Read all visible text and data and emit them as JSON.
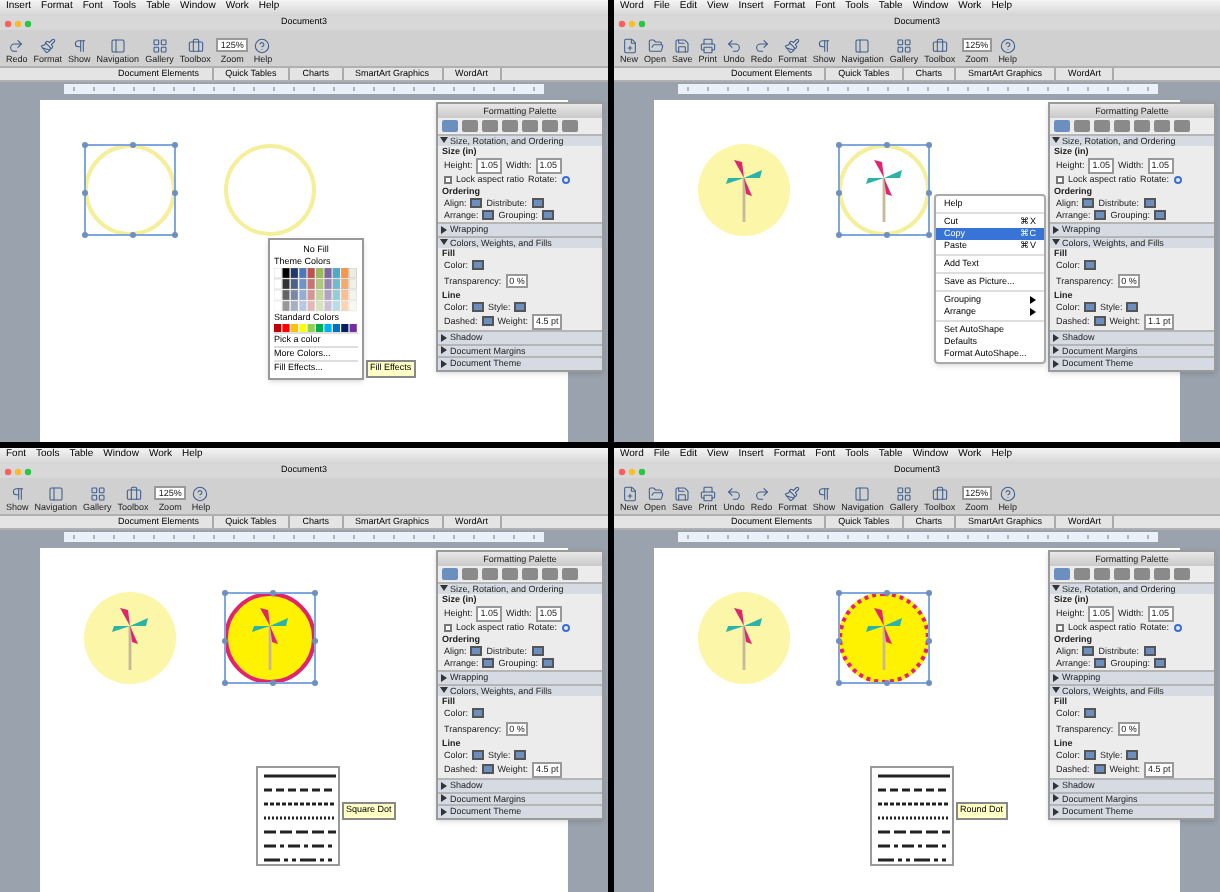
{
  "panes": [
    {
      "menus": [
        "Insert",
        "Format",
        "Font",
        "Tools",
        "Table",
        "Window",
        "Work",
        "Help"
      ],
      "title": "Document3",
      "toolbar": [
        {
          "kind": "redo",
          "label": "Redo"
        },
        {
          "kind": "format",
          "label": "Format"
        },
        {
          "kind": "show",
          "label": "Show"
        },
        {
          "kind": "navigation",
          "label": "Navigation"
        },
        {
          "kind": "gallery",
          "label": "Gallery"
        },
        {
          "kind": "toolbox",
          "label": "Toolbox"
        },
        {
          "kind": "zoom",
          "label": "Zoom",
          "value": "125%"
        },
        {
          "kind": "help",
          "label": "Help"
        }
      ],
      "ribbon_tabs": [
        "Document Elements",
        "Quick Tables",
        "Charts",
        "SmartArt Graphics",
        "WordArt"
      ],
      "shapes": [
        {
          "kind": "ring",
          "selected": true
        },
        {
          "kind": "ring",
          "selected": false
        }
      ],
      "palette": {
        "title": "Formatting Palette",
        "rows": [
          {
            "kind": "header",
            "text": "Size, Rotation, and Ordering",
            "expanded": true
          },
          {
            "kind": "label",
            "text": "Size (in)"
          },
          {
            "kind": "fields",
            "items": [
              {
                "label": "Height:",
                "value": "1.05"
              },
              {
                "label": "Width:",
                "value": "1.05"
              }
            ]
          },
          {
            "kind": "check",
            "text": "Lock aspect ratio",
            "checked": false,
            "extra": "Rotate:"
          },
          {
            "kind": "label",
            "text": "Ordering"
          },
          {
            "kind": "fields",
            "items": [
              {
                "label": "Align:"
              },
              {
                "label": "Distribute:"
              }
            ]
          },
          {
            "kind": "fields",
            "items": [
              {
                "label": "Arrange:"
              },
              {
                "label": "Grouping:"
              }
            ]
          },
          {
            "kind": "header",
            "text": "Wrapping",
            "expanded": false
          },
          {
            "kind": "header",
            "text": "Colors, Weights, and Fills",
            "expanded": true
          },
          {
            "kind": "label",
            "text": "Fill"
          },
          {
            "kind": "fields",
            "items": [
              {
                "label": "Color:"
              }
            ]
          },
          {
            "kind": "fields",
            "items": [
              {
                "label": "Transparency:",
                "value": "0 %"
              }
            ]
          },
          {
            "kind": "label",
            "text": "Line"
          },
          {
            "kind": "fields",
            "items": [
              {
                "label": "Color:"
              },
              {
                "label": "Style:"
              }
            ]
          },
          {
            "kind": "fields",
            "items": [
              {
                "label": "Dashed:"
              },
              {
                "label": "Weight:",
                "value": "4.5 pt"
              }
            ]
          },
          {
            "kind": "header",
            "text": "Shadow",
            "expanded": false
          },
          {
            "kind": "header",
            "text": "Document Margins",
            "expanded": false
          },
          {
            "kind": "header",
            "text": "Document Theme",
            "expanded": false
          }
        ]
      },
      "overlay": {
        "kind": "color_menu",
        "no_fill": "No Fill",
        "theme": "Theme Colors",
        "standard": "Standard Colors",
        "items": [
          "Pick a color",
          "More Colors...",
          "Fill Effects..."
        ],
        "tooltip": "Fill Effects"
      }
    },
    {
      "menus": [
        "Word",
        "File",
        "Edit",
        "View",
        "Insert",
        "Format",
        "Font",
        "Tools",
        "Table",
        "Window",
        "Work",
        "Help"
      ],
      "title": "Document3",
      "toolbar": [
        {
          "kind": "new",
          "label": "New"
        },
        {
          "kind": "open",
          "label": "Open"
        },
        {
          "kind": "save",
          "label": "Save"
        },
        {
          "kind": "print",
          "label": "Print"
        },
        {
          "kind": "undo",
          "label": "Undo"
        },
        {
          "kind": "redo",
          "label": "Redo"
        },
        {
          "kind": "format",
          "label": "Format"
        },
        {
          "kind": "show",
          "label": "Show"
        },
        {
          "kind": "navigation",
          "label": "Navigation"
        },
        {
          "kind": "gallery",
          "label": "Gallery"
        },
        {
          "kind": "toolbox",
          "label": "Toolbox"
        },
        {
          "kind": "zoom",
          "label": "Zoom",
          "value": "125%"
        },
        {
          "kind": "help",
          "label": "Help"
        }
      ],
      "ribbon_tabs": [
        "Document Elements",
        "Quick Tables",
        "Charts",
        "SmartArt Graphics",
        "WordArt"
      ],
      "shapes": [
        {
          "kind": "pale_pinwheel",
          "selected": false
        },
        {
          "kind": "ring_pinwheel",
          "selected": true
        }
      ],
      "palette": {
        "title": "Formatting Palette",
        "rows": [
          {
            "kind": "header",
            "text": "Size, Rotation, and Ordering",
            "expanded": true
          },
          {
            "kind": "label",
            "text": "Size (in)"
          },
          {
            "kind": "fields",
            "items": [
              {
                "label": "Height:",
                "value": "1.05"
              },
              {
                "label": "Width:",
                "value": "1.05"
              }
            ]
          },
          {
            "kind": "check",
            "text": "Lock aspect ratio",
            "checked": false,
            "extra": "Rotate:"
          },
          {
            "kind": "label",
            "text": "Ordering"
          },
          {
            "kind": "fields",
            "items": [
              {
                "label": "Align:"
              },
              {
                "label": "Distribute:"
              }
            ]
          },
          {
            "kind": "fields",
            "items": [
              {
                "label": "Arrange:"
              },
              {
                "label": "Grouping:"
              }
            ]
          },
          {
            "kind": "header",
            "text": "Wrapping",
            "expanded": false
          },
          {
            "kind": "header",
            "text": "Colors, Weights, and Fills",
            "expanded": true
          },
          {
            "kind": "label",
            "text": "Fill"
          },
          {
            "kind": "fields",
            "items": [
              {
                "label": "Color:"
              }
            ]
          },
          {
            "kind": "fields",
            "items": [
              {
                "label": "Transparency:",
                "value": "0 %"
              }
            ]
          },
          {
            "kind": "label",
            "text": "Line"
          },
          {
            "kind": "fields",
            "items": [
              {
                "label": "Color:"
              },
              {
                "label": "Style:"
              }
            ]
          },
          {
            "kind": "fields",
            "items": [
              {
                "label": "Dashed:"
              },
              {
                "label": "Weight:",
                "value": "1.1 pt"
              }
            ]
          },
          {
            "kind": "header",
            "text": "Shadow",
            "expanded": false
          },
          {
            "kind": "header",
            "text": "Document Margins",
            "expanded": false
          },
          {
            "kind": "header",
            "text": "Document Theme",
            "expanded": false
          }
        ]
      },
      "overlay": {
        "kind": "context_menu",
        "items": [
          {
            "kind": "item",
            "label": "Help",
            "selected": false,
            "submenu": false
          },
          {
            "kind": "separator"
          },
          {
            "kind": "item",
            "label": "Cut",
            "shortcut": "⌘X",
            "selected": false,
            "submenu": false
          },
          {
            "kind": "item",
            "label": "Copy",
            "shortcut": "⌘C",
            "selected": true,
            "submenu": false
          },
          {
            "kind": "item",
            "label": "Paste",
            "shortcut": "⌘V",
            "selected": false,
            "submenu": false
          },
          {
            "kind": "separator"
          },
          {
            "kind": "item",
            "label": "Add Text",
            "selected": false,
            "submenu": false
          },
          {
            "kind": "separator"
          },
          {
            "kind": "item",
            "label": "Save as Picture...",
            "selected": false,
            "submenu": false
          },
          {
            "kind": "separator"
          },
          {
            "kind": "item",
            "label": "Grouping",
            "selected": false,
            "submenu": true
          },
          {
            "kind": "item",
            "label": "Arrange",
            "selected": false,
            "submenu": true
          },
          {
            "kind": "separator"
          },
          {
            "kind": "item",
            "label": "Set AutoShape Defaults",
            "selected": false,
            "submenu": false
          },
          {
            "kind": "item",
            "label": "Format AutoShape...",
            "selected": false,
            "submenu": false
          }
        ]
      }
    },
    {
      "menus": [
        "Font",
        "Tools",
        "Table",
        "Window",
        "Work",
        "Help"
      ],
      "title": "Document3",
      "toolbar": [
        {
          "kind": "show",
          "label": "Show"
        },
        {
          "kind": "navigation",
          "label": "Navigation"
        },
        {
          "kind": "gallery",
          "label": "Gallery"
        },
        {
          "kind": "toolbox",
          "label": "Toolbox"
        },
        {
          "kind": "zoom",
          "label": "Zoom",
          "value": "125%"
        },
        {
          "kind": "help",
          "label": "Help"
        }
      ],
      "ribbon_tabs": [
        "Document Elements",
        "Quick Tables",
        "Charts",
        "SmartArt Graphics",
        "WordArt"
      ],
      "shapes": [
        {
          "kind": "pale_pinwheel",
          "selected": false
        },
        {
          "kind": "outlined_pinwheel",
          "selected": true
        }
      ],
      "palette": {
        "title": "Formatting Palette",
        "rows": [
          {
            "kind": "header",
            "text": "Size, Rotation, and Ordering",
            "expanded": true
          },
          {
            "kind": "label",
            "text": "Size (in)"
          },
          {
            "kind": "fields",
            "items": [
              {
                "label": "Height:",
                "value": "1.05"
              },
              {
                "label": "Width:",
                "value": "1.05"
              }
            ]
          },
          {
            "kind": "check",
            "text": "Lock aspect ratio",
            "checked": false,
            "extra": "Rotate:"
          },
          {
            "kind": "label",
            "text": "Ordering"
          },
          {
            "kind": "fields",
            "items": [
              {
                "label": "Align:"
              },
              {
                "label": "Distribute:"
              }
            ]
          },
          {
            "kind": "fields",
            "items": [
              {
                "label": "Arrange:"
              },
              {
                "label": "Grouping:"
              }
            ]
          },
          {
            "kind": "header",
            "text": "Wrapping",
            "expanded": false
          },
          {
            "kind": "header",
            "text": "Colors, Weights, and Fills",
            "expanded": true
          },
          {
            "kind": "label",
            "text": "Fill"
          },
          {
            "kind": "fields",
            "items": [
              {
                "label": "Color:"
              }
            ]
          },
          {
            "kind": "fields",
            "items": [
              {
                "label": "Transparency:",
                "value": "0 %"
              }
            ]
          },
          {
            "kind": "label",
            "text": "Line"
          },
          {
            "kind": "fields",
            "items": [
              {
                "label": "Color:"
              },
              {
                "label": "Style:"
              }
            ]
          },
          {
            "kind": "fields",
            "items": [
              {
                "label": "Dashed:"
              },
              {
                "label": "Weight:",
                "value": "4.5 pt"
              }
            ]
          },
          {
            "kind": "header",
            "text": "Shadow",
            "expanded": false
          },
          {
            "kind": "header",
            "text": "Document Margins",
            "expanded": false
          },
          {
            "kind": "header",
            "text": "Document Theme",
            "expanded": false
          }
        ]
      },
      "overlay": {
        "kind": "dash_menu",
        "tooltip": "Square Dot"
      }
    },
    {
      "menus": [
        "Word",
        "File",
        "Edit",
        "View",
        "Insert",
        "Format",
        "Font",
        "Tools",
        "Table",
        "Window",
        "Work",
        "Help"
      ],
      "title": "Document3",
      "toolbar": [
        {
          "kind": "new",
          "label": "New"
        },
        {
          "kind": "open",
          "label": "Open"
        },
        {
          "kind": "save",
          "label": "Save"
        },
        {
          "kind": "print",
          "label": "Print"
        },
        {
          "kind": "undo",
          "label": "Undo"
        },
        {
          "kind": "redo",
          "label": "Redo"
        },
        {
          "kind": "format",
          "label": "Format"
        },
        {
          "kind": "show",
          "label": "Show"
        },
        {
          "kind": "navigation",
          "label": "Navigation"
        },
        {
          "kind": "gallery",
          "label": "Gallery"
        },
        {
          "kind": "toolbox",
          "label": "Toolbox"
        },
        {
          "kind": "zoom",
          "label": "Zoom",
          "value": "125%"
        },
        {
          "kind": "help",
          "label": "Help"
        }
      ],
      "ribbon_tabs": [
        "Document Elements",
        "Quick Tables",
        "Charts",
        "SmartArt Graphics",
        "WordArt"
      ],
      "shapes": [
        {
          "kind": "pale_pinwheel",
          "selected": false
        },
        {
          "kind": "dotted_pinwheel",
          "selected": true
        }
      ],
      "palette": {
        "title": "Formatting Palette",
        "rows": [
          {
            "kind": "header",
            "text": "Size, Rotation, and Ordering",
            "expanded": true
          },
          {
            "kind": "label",
            "text": "Size (in)"
          },
          {
            "kind": "fields",
            "items": [
              {
                "label": "Height:",
                "value": "1.05"
              },
              {
                "label": "Width:",
                "value": "1.05"
              }
            ]
          },
          {
            "kind": "check",
            "text": "Lock aspect ratio",
            "checked": false,
            "extra": "Rotate:"
          },
          {
            "kind": "label",
            "text": "Ordering"
          },
          {
            "kind": "fields",
            "items": [
              {
                "label": "Align:"
              },
              {
                "label": "Distribute:"
              }
            ]
          },
          {
            "kind": "fields",
            "items": [
              {
                "label": "Arrange:"
              },
              {
                "label": "Grouping:"
              }
            ]
          },
          {
            "kind": "header",
            "text": "Wrapping",
            "expanded": false
          },
          {
            "kind": "header",
            "text": "Colors, Weights, and Fills",
            "expanded": true
          },
          {
            "kind": "label",
            "text": "Fill"
          },
          {
            "kind": "fields",
            "items": [
              {
                "label": "Color:"
              }
            ]
          },
          {
            "kind": "fields",
            "items": [
              {
                "label": "Transparency:",
                "value": "0 %"
              }
            ]
          },
          {
            "kind": "label",
            "text": "Line"
          },
          {
            "kind": "fields",
            "items": [
              {
                "label": "Color:"
              },
              {
                "label": "Style:"
              }
            ]
          },
          {
            "kind": "fields",
            "items": [
              {
                "label": "Dashed:"
              },
              {
                "label": "Weight:",
                "value": "4.5 pt"
              }
            ]
          },
          {
            "kind": "header",
            "text": "Shadow",
            "expanded": false
          },
          {
            "kind": "header",
            "text": "Document Margins",
            "expanded": false
          },
          {
            "kind": "header",
            "text": "Document Theme",
            "expanded": false
          }
        ]
      },
      "overlay": {
        "kind": "dash_menu",
        "tooltip": "Round Dot"
      }
    }
  ]
}
